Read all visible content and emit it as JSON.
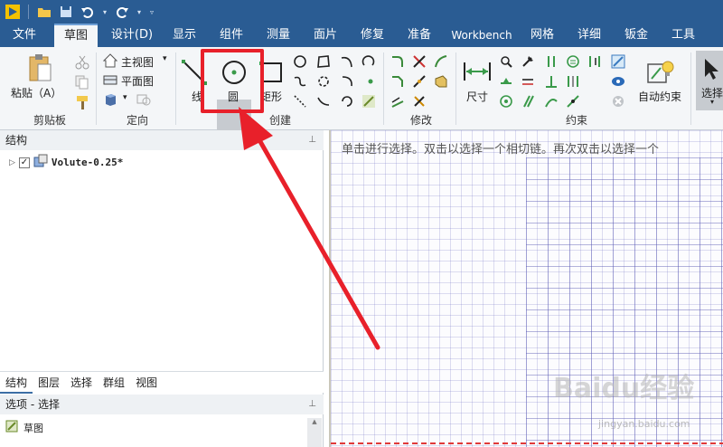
{
  "menu": {
    "tabs": [
      {
        "label": "文件"
      },
      {
        "label": "草图"
      },
      {
        "label": "设计(D)"
      },
      {
        "label": "显示"
      },
      {
        "label": "组件"
      },
      {
        "label": "测量"
      },
      {
        "label": "面片"
      },
      {
        "label": "修复"
      },
      {
        "label": "准备"
      },
      {
        "label": "Workbench"
      },
      {
        "label": "网格"
      },
      {
        "label": "详细"
      },
      {
        "label": "钣金"
      },
      {
        "label": "工具"
      }
    ]
  },
  "ribbon": {
    "paste_label": "粘贴（A）",
    "clipboard_group": "剪贴板",
    "main_view": "主视图",
    "plane_view": "平面图",
    "orient_group": "定向",
    "line_label": "线",
    "circle_label": "圆",
    "rect_label": "矩形",
    "create_group": "创建",
    "modify_group": "修改",
    "dimension_label": "尺寸",
    "constraint_group": "约束",
    "auto_constraint": "自动约束",
    "select_label": "选择"
  },
  "structure_panel": {
    "title": "结构",
    "item": "Volute-0.25*"
  },
  "bottom_tabs": [
    {
      "label": "结构"
    },
    {
      "label": "图层"
    },
    {
      "label": "选择"
    },
    {
      "label": "群组"
    },
    {
      "label": "视图"
    }
  ],
  "options_panel": {
    "title": "选项 - 选择",
    "item": "草图"
  },
  "canvas": {
    "hint": "单击进行选择。双击以选择一个相切链。再次双击以选择一个"
  },
  "watermark": {
    "text": "Baidu经验",
    "sub": "jingyan.baidu.com"
  },
  "colors": {
    "titlebar": "#2a5c93",
    "highlight": "#e8202a"
  }
}
